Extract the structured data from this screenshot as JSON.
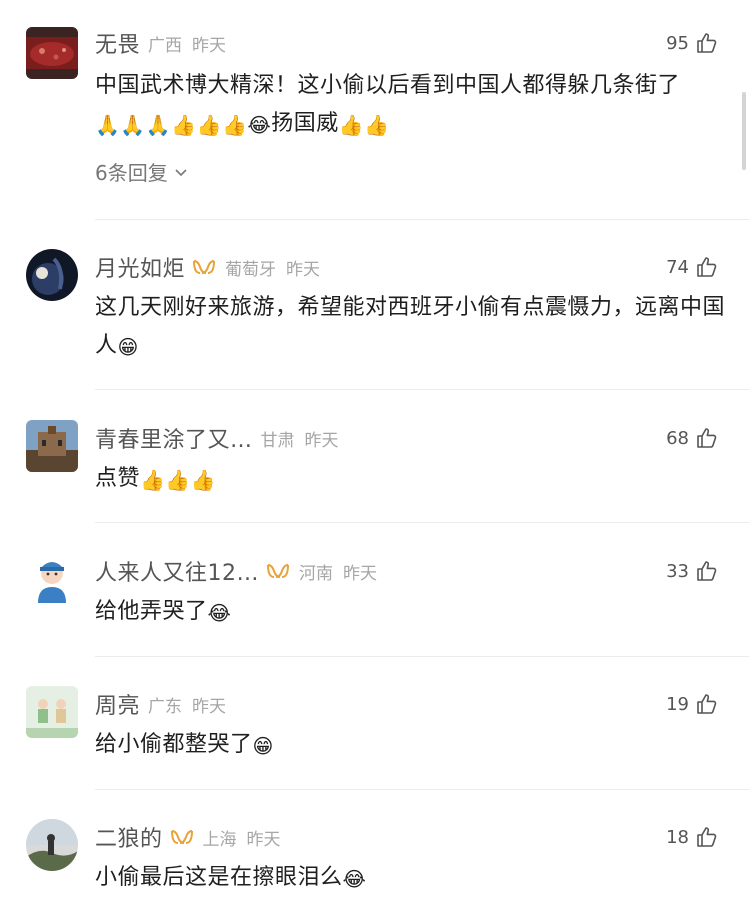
{
  "comments": [
    {
      "username": "无畏",
      "location": "广西",
      "time": "昨天",
      "likes": "95",
      "text": "中国武术博大精深！这小偷以后看到中国人都得躲几条街了",
      "emoji": "🙏🙏🙏👍👍👍😂",
      "text_after": "扬国威",
      "emoji_after": "👍👍",
      "replies": "6条回复"
    },
    {
      "username": "月光如炬",
      "vip": true,
      "location": "葡萄牙",
      "time": "昨天",
      "likes": "74",
      "text": "这几天刚好来旅游，希望能对西班牙小偷有点震慑力，远离中国人",
      "emoji": "😁"
    },
    {
      "username": "青春里涂了又…",
      "location": "甘肃",
      "time": "昨天",
      "likes": "68",
      "text": "点赞",
      "emoji": "👍👍👍"
    },
    {
      "username": "人来人又往12…",
      "vip": true,
      "location": "河南",
      "time": "昨天",
      "likes": "33",
      "text": "给他弄哭了",
      "emoji": "😂"
    },
    {
      "username": "周亮",
      "location": "广东",
      "time": "昨天",
      "likes": "19",
      "text": "给小偷都整哭了",
      "emoji": "😁"
    },
    {
      "username": "二狼的",
      "vip": true,
      "location": "上海",
      "time": "昨天",
      "likes": "18",
      "text": "小偷最后这是在擦眼泪么",
      "emoji": "😂"
    }
  ],
  "icons": {
    "like": "thumbs-up-icon",
    "vip": "vip-badge-icon",
    "expand": "chevron-down-icon"
  },
  "colors": {
    "vip_badge": "#e8a33a",
    "secondary_text": "#a6a6a6",
    "divider": "#ececec"
  }
}
